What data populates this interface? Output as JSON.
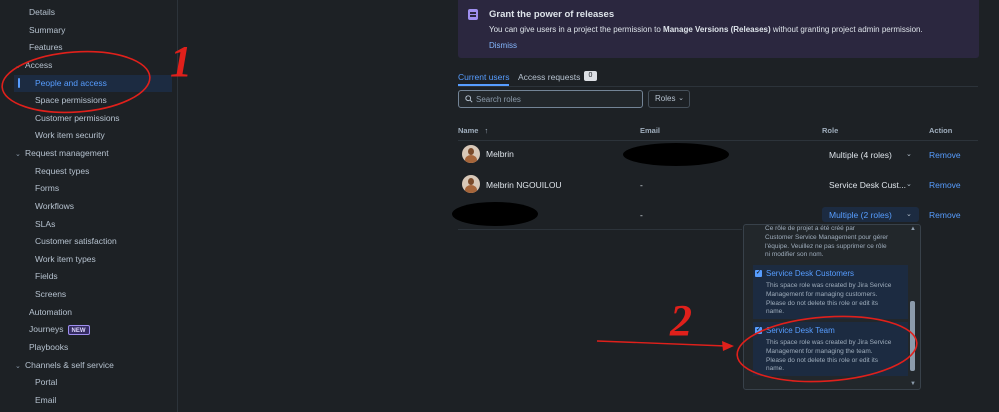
{
  "sidebar": {
    "items": [
      {
        "label": "Details"
      },
      {
        "label": "Summary"
      },
      {
        "label": "Features"
      },
      {
        "label": "Access"
      },
      {
        "label": "People and access"
      },
      {
        "label": "Space permissions"
      },
      {
        "label": "Customer permissions"
      },
      {
        "label": "Work item security"
      },
      {
        "label": "Request management"
      },
      {
        "label": "Request types"
      },
      {
        "label": "Forms"
      },
      {
        "label": "Workflows"
      },
      {
        "label": "SLAs"
      },
      {
        "label": "Customer satisfaction"
      },
      {
        "label": "Work item types"
      },
      {
        "label": "Fields"
      },
      {
        "label": "Screens"
      },
      {
        "label": "Automation"
      },
      {
        "label": "Journeys"
      },
      {
        "label": "Playbooks"
      },
      {
        "label": "Channels & self service"
      },
      {
        "label": "Portal"
      },
      {
        "label": "Email"
      }
    ],
    "journeys_badge": "NEW"
  },
  "banner": {
    "title": "Grant the power of releases",
    "text_before": "You can give users in a project the permission to ",
    "text_bold": "Manage Versions (Releases)",
    "text_after": " without granting project admin permission.",
    "dismiss": "Dismiss"
  },
  "tabs": {
    "current_users": "Current users",
    "access_requests": "Access requests",
    "access_requests_count": "0"
  },
  "search": {
    "placeholder": "Search roles",
    "roles_button": "Roles"
  },
  "table": {
    "headers": {
      "name": "Name",
      "email": "Email",
      "role": "Role",
      "action": "Action"
    },
    "rows": [
      {
        "name": "Melbrin",
        "email": "",
        "role": "Multiple (4 roles)",
        "action": "Remove"
      },
      {
        "name": "Melbrin NGOUILOU",
        "email": "-",
        "role": "Service Desk Cust...",
        "action": "Remove"
      },
      {
        "name": "",
        "email": "-",
        "role": "Multiple (2 roles)",
        "action": "Remove"
      }
    ]
  },
  "dropdown": {
    "partial_description": [
      "Ce rôle de projet a été créé par",
      "Customer Service Management pour gérer",
      "l'équipe. Veuillez ne pas supprimer ce rôle",
      "ni modifier son nom."
    ],
    "options": [
      {
        "title": "Service Desk Customers",
        "checked": true,
        "description": [
          "This space role was created by Jira Service",
          "Management for managing customers.",
          "Please do not delete this role or edit its",
          "name."
        ]
      },
      {
        "title": "Service Desk Team",
        "checked": true,
        "description": [
          "This space role was created by Jira Service",
          "Management for managing the team.",
          "Please do not delete this role or edit its",
          "name."
        ]
      }
    ]
  },
  "annotations": {
    "label_1": "1",
    "label_2": "2",
    "color": "#e0201b"
  }
}
